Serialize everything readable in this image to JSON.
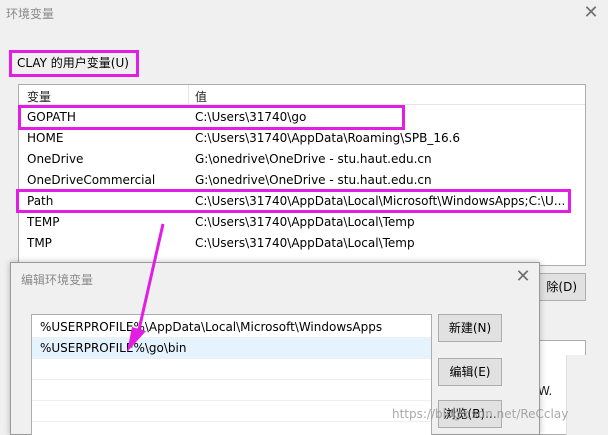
{
  "window": {
    "title": "环境变量",
    "close_glyph": "✕"
  },
  "user_vars": {
    "group_label": "CLAY 的用户变量(U)",
    "columns": [
      "变量",
      "值"
    ],
    "rows": [
      {
        "name": "GOPATH",
        "value": "C:\\Users\\31740\\go"
      },
      {
        "name": "HOME",
        "value": "C:\\Users\\31740\\AppData\\Roaming\\SPB_16.6"
      },
      {
        "name": "OneDrive",
        "value": "G:\\onedrive\\OneDrive - stu.haut.edu.cn"
      },
      {
        "name": "OneDriveCommercial",
        "value": "G:\\onedrive\\OneDrive - stu.haut.edu.cn"
      },
      {
        "name": "Path",
        "value": "C:\\Users\\31740\\AppData\\Local\\Microsoft\\WindowsApps;C:\\U..."
      },
      {
        "name": "TEMP",
        "value": "C:\\Users\\31740\\AppData\\Local\\Temp"
      },
      {
        "name": "TMP",
        "value": "C:\\Users\\31740\\AppData\\Local\\Temp"
      }
    ],
    "delete_button_partial": "除(D)",
    "lower_peek_text": "W."
  },
  "edit_dialog": {
    "title": "编辑环境变量",
    "close_glyph": "✕",
    "entries": [
      "%USERPROFILE%\\AppData\\Local\\Microsoft\\WindowsApps",
      "%USERPROFILE%\\go\\bin"
    ],
    "buttons": {
      "new": "新建(N)",
      "edit": "编辑(E)",
      "browse": "浏览(B)..."
    }
  },
  "watermark": "https://blog.csdn.net/ReCclay",
  "colors": {
    "highlight": "#e21ee5",
    "selection": "#e5f3ff"
  }
}
